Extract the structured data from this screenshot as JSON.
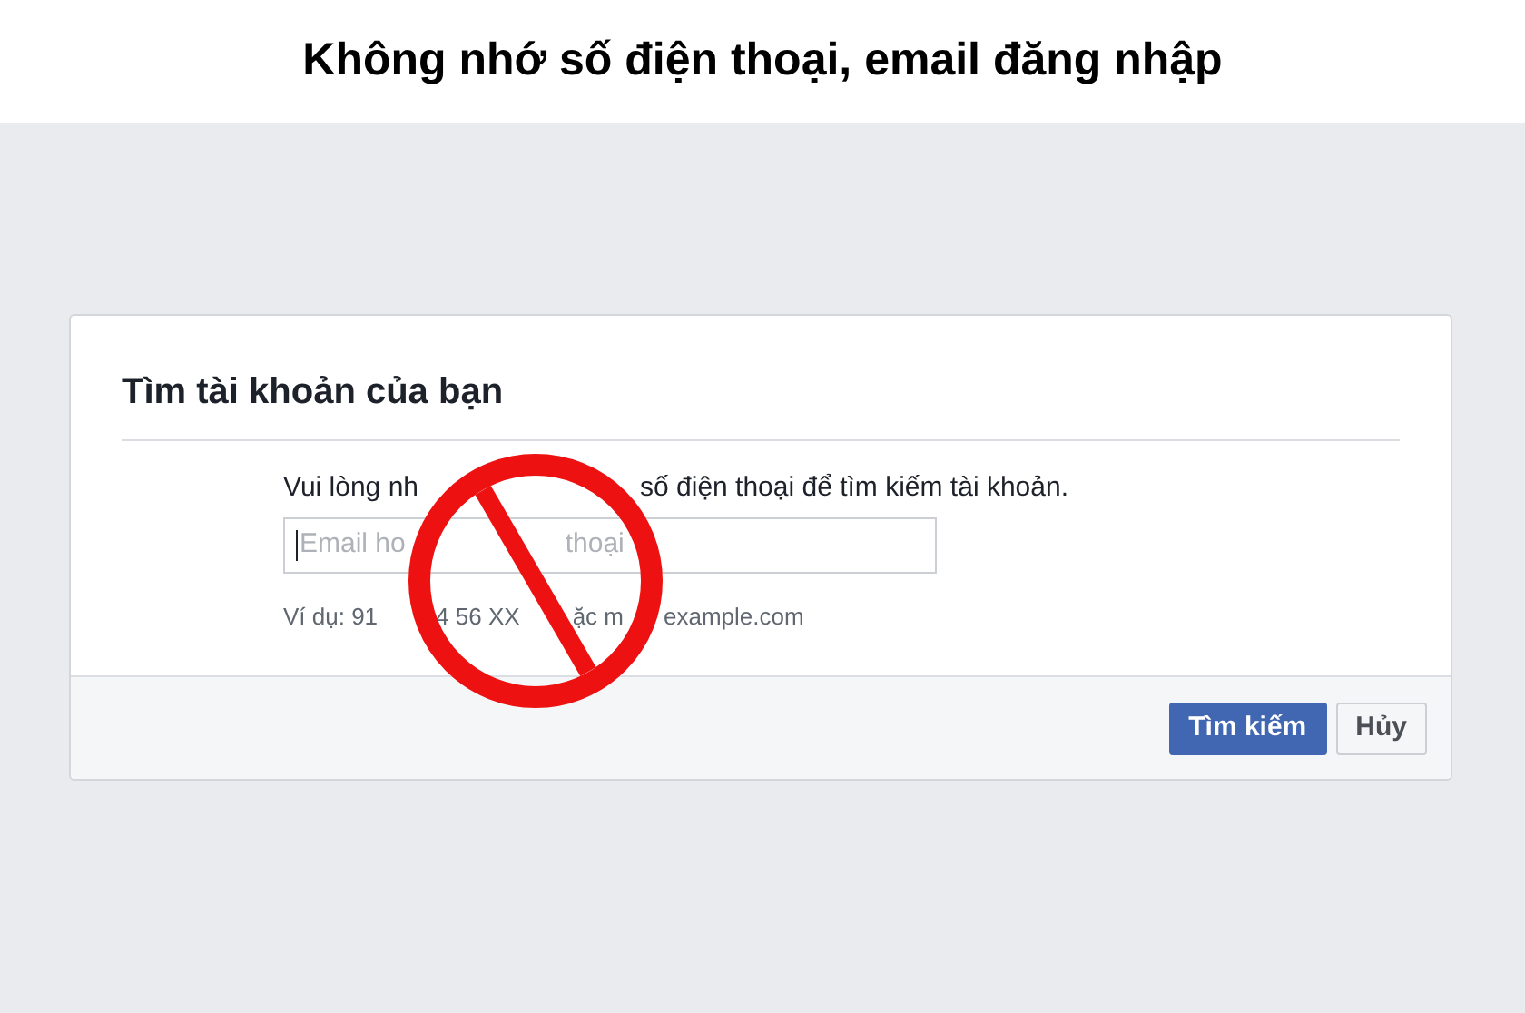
{
  "banner": {
    "title": "Không nhớ số điện thoại, email đăng nhập"
  },
  "dialog": {
    "title": "Tìm tài khoản của bạn",
    "instruction_fragments": [
      "Vui lòng nh",
      "số điện thoại để tìm kiếm tài khoản."
    ],
    "field": {
      "hint_fragments": [
        "Email ho",
        "thoại"
      ]
    },
    "example_fragments": [
      "Ví dụ: 91",
      "4 56 XX",
      "ặc m",
      "example.com"
    ],
    "buttons": [
      {
        "label": "Tìm kiếm",
        "kind": "primary"
      },
      {
        "label": "Hủy",
        "kind": "secondary"
      }
    ]
  },
  "overlay": {
    "kind": "prohibition"
  }
}
